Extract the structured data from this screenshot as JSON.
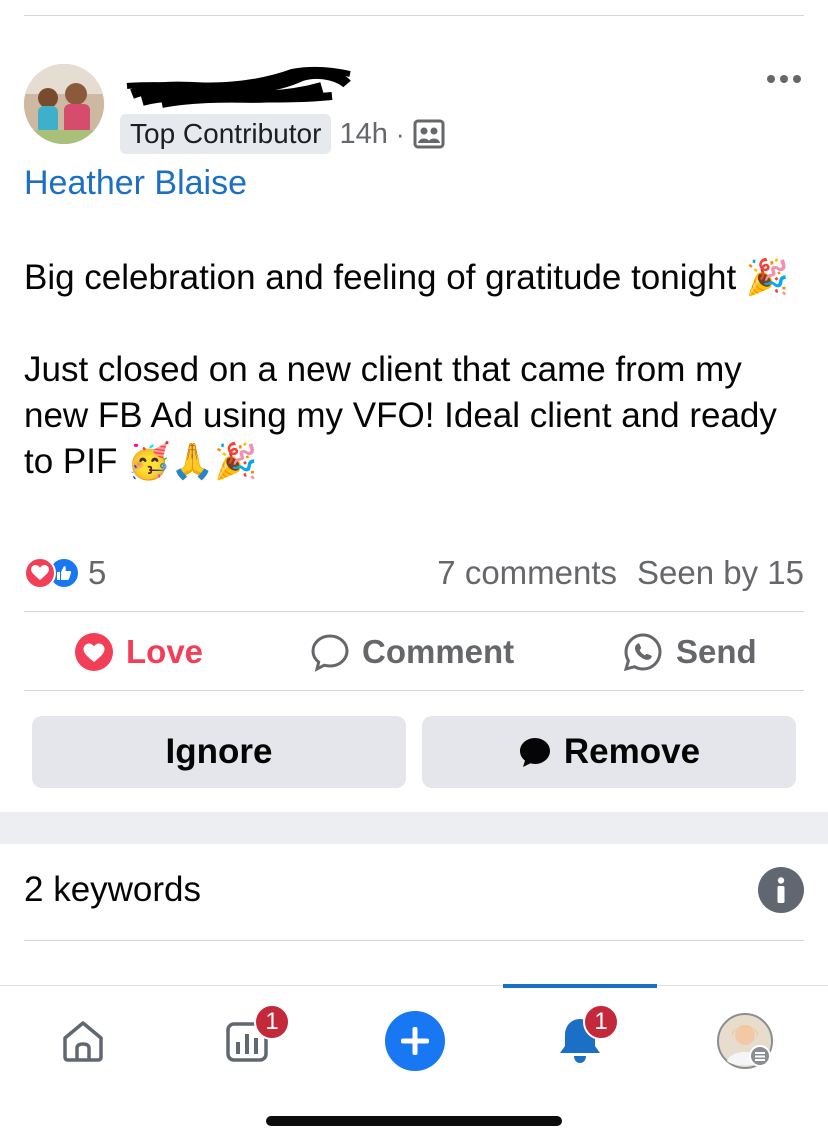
{
  "post": {
    "badge": "Top Contributor",
    "time": "14h",
    "separator": "·",
    "audience_icon": "group-icon",
    "author": "Heather Blaise",
    "body_line1": "Big celebration and feeling of gratitude tonight",
    "body_line1_emoji": "🎉",
    "body_line2": "Just closed on a new client that came from my new FB Ad using my VFO! Ideal client and ready to PIF",
    "body_line2_emoji": "🥳🙏🎉"
  },
  "stats": {
    "reaction_count": "5",
    "comments": "7 comments",
    "seen": "Seen by 15"
  },
  "actions": {
    "love": "Love",
    "comment": "Comment",
    "send": "Send"
  },
  "moderation": {
    "ignore": "Ignore",
    "remove": "Remove"
  },
  "keywords": {
    "label": "2 keywords"
  },
  "nav": {
    "insights_badge": "1",
    "notifications_badge": "1",
    "active": "notifications"
  },
  "colors": {
    "accent": "#1b6fc4",
    "love": "#f33e58",
    "badge": "#c4283b"
  }
}
